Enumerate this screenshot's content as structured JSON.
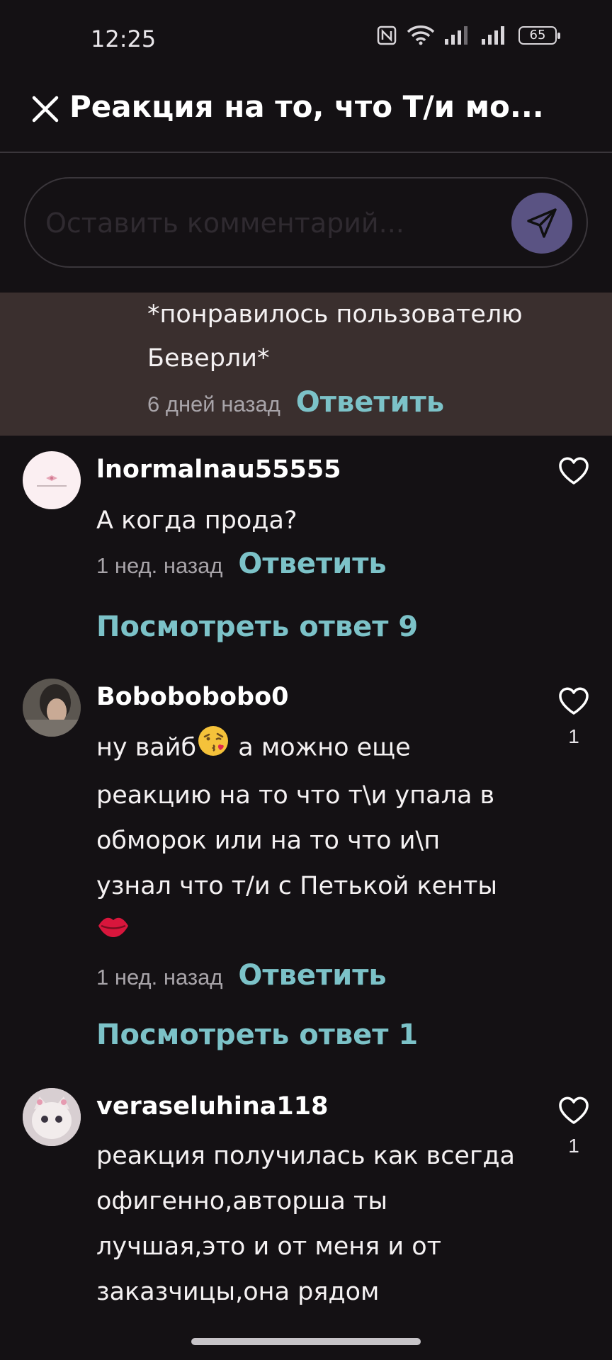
{
  "status_bar": {
    "time": "12:25",
    "battery": "65"
  },
  "header": {
    "title": "Реакция на то, что Т/и мо..."
  },
  "comment_input": {
    "placeholder": "Оставить комментарий..."
  },
  "highlighted_comment": {
    "text": "*понравилось пользователю Беверли*",
    "time": "6 дней назад",
    "reply_label": "Ответить"
  },
  "comments": [
    {
      "username": "lnormalnau55555",
      "text": "А когда прода?",
      "time": "1 нед. назад",
      "reply_label": "Ответить",
      "view_replies_label": "Посмотреть ответ 9",
      "likes": ""
    },
    {
      "username": "Bobobobobo0",
      "text_part1": "ну вайб",
      "text_part2": " а можно еще реакцию на то что т\\и упала в обморок или на то что и\\п узнал что т/и с Петькой кенты",
      "time": "1 нед. назад",
      "reply_label": "Ответить",
      "view_replies_label": "Посмотреть ответ 1",
      "likes": "1"
    },
    {
      "username": "veraseluhina118",
      "text": "реакция получилась как всегда офигенно,авторша ты лучшая,это и от меня и от заказчицы,она рядом",
      "likes": "1"
    }
  ],
  "icons": [
    "close-icon",
    "send-icon",
    "heart-icon",
    "nfc-icon",
    "wifi-icon",
    "signal-icon",
    "battery-icon",
    "kiss-emoji",
    "lips-emoji"
  ],
  "colors": {
    "background": "#141114",
    "accent": "#7cc2c8",
    "send_button": "#5a5383",
    "highlight_bg": "#3a2f2e"
  }
}
